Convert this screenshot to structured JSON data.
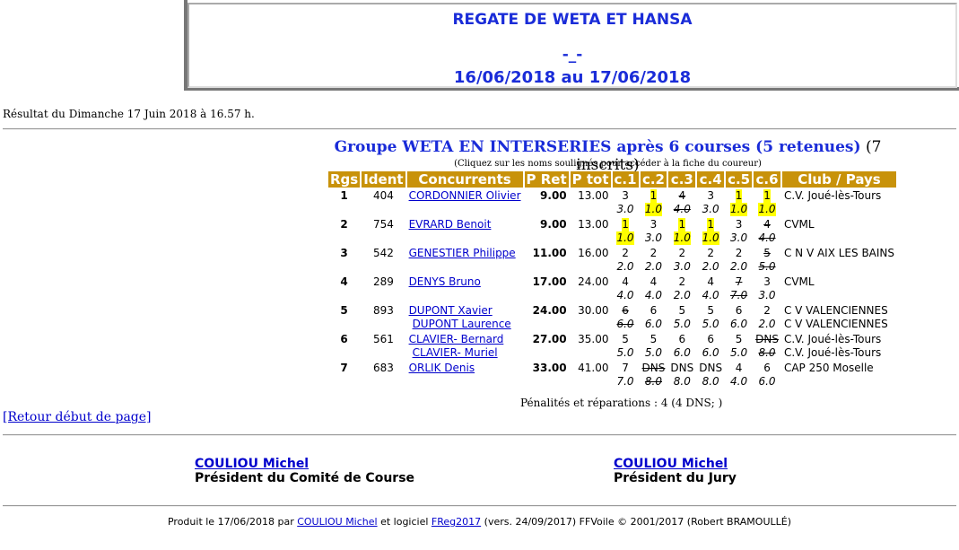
{
  "header": {
    "title": "REGATE DE WETA ET HANSA",
    "separator": "-_-",
    "dates": "16/06/2018 au 17/06/2018"
  },
  "result_line": "Résultat du Dimanche 17 Juin 2018 à 16.57 h.",
  "group": {
    "title": "Groupe WETA EN INTERSERIES après 6 courses (5 retenues)",
    "count": "(7 inscrits)",
    "note": "(Cliquez sur les noms soulignés pour accéder à la fiche du coureur)"
  },
  "table": {
    "headers": [
      "Rgs",
      "Ident",
      "Concurrents",
      "P Ret",
      "P tot",
      "c.1",
      "c.2",
      "c.3",
      "c.4",
      "c.5",
      "c.6",
      "Club / Pays"
    ],
    "rows": [
      {
        "rank": "1",
        "ident": "404",
        "names": [
          "CORDONNIER Olivier"
        ],
        "pret": "9.00",
        "ptot": "13.00",
        "races": [
          {
            "r": "3",
            "p": "3.0",
            "hl": false,
            "s": false
          },
          {
            "r": "1",
            "p": "1.0",
            "hl": true,
            "s": false
          },
          {
            "r": "4",
            "p": "4.0",
            "hl": false,
            "s": true
          },
          {
            "r": "3",
            "p": "3.0",
            "hl": false,
            "s": false
          },
          {
            "r": "1",
            "p": "1.0",
            "hl": true,
            "s": false
          },
          {
            "r": "1",
            "p": "1.0",
            "hl": true,
            "s": false
          }
        ],
        "clubs": [
          "C.V. Joué-lès-Tours"
        ]
      },
      {
        "rank": "2",
        "ident": "754",
        "names": [
          "EVRARD Benoit"
        ],
        "pret": "9.00",
        "ptot": "13.00",
        "races": [
          {
            "r": "1",
            "p": "1.0",
            "hl": true,
            "s": false
          },
          {
            "r": "3",
            "p": "3.0",
            "hl": false,
            "s": false
          },
          {
            "r": "1",
            "p": "1.0",
            "hl": true,
            "s": false
          },
          {
            "r": "1",
            "p": "1.0",
            "hl": true,
            "s": false
          },
          {
            "r": "3",
            "p": "3.0",
            "hl": false,
            "s": false
          },
          {
            "r": "4",
            "p": "4.0",
            "hl": false,
            "s": true
          }
        ],
        "clubs": [
          "CVML"
        ]
      },
      {
        "rank": "3",
        "ident": "542",
        "names": [
          "GENESTIER Philippe"
        ],
        "pret": "11.00",
        "ptot": "16.00",
        "races": [
          {
            "r": "2",
            "p": "2.0",
            "hl": false,
            "s": false
          },
          {
            "r": "2",
            "p": "2.0",
            "hl": false,
            "s": false
          },
          {
            "r": "2",
            "p": "3.0",
            "hl": false,
            "s": false
          },
          {
            "r": "2",
            "p": "2.0",
            "hl": false,
            "s": false
          },
          {
            "r": "2",
            "p": "2.0",
            "hl": false,
            "s": false
          },
          {
            "r": "5",
            "p": "5.0",
            "hl": false,
            "s": true
          }
        ],
        "clubs": [
          "C N V AIX LES BAINS"
        ]
      },
      {
        "rank": "4",
        "ident": "289",
        "names": [
          "DENYS Bruno"
        ],
        "pret": "17.00",
        "ptot": "24.00",
        "races": [
          {
            "r": "4",
            "p": "4.0",
            "hl": false,
            "s": false
          },
          {
            "r": "4",
            "p": "4.0",
            "hl": false,
            "s": false
          },
          {
            "r": "2",
            "p": "2.0",
            "hl": false,
            "s": false
          },
          {
            "r": "4",
            "p": "4.0",
            "hl": false,
            "s": false
          },
          {
            "r": "7",
            "p": "7.0",
            "hl": false,
            "s": true
          },
          {
            "r": "3",
            "p": "3.0",
            "hl": false,
            "s": false
          }
        ],
        "clubs": [
          "CVML"
        ]
      },
      {
        "rank": "5",
        "ident": "893",
        "names": [
          "DUPONT Xavier",
          "DUPONT Laurence"
        ],
        "pret": "24.00",
        "ptot": "30.00",
        "races": [
          {
            "r": "6",
            "p": "6.0",
            "hl": false,
            "s": true
          },
          {
            "r": "6",
            "p": "6.0",
            "hl": false,
            "s": false
          },
          {
            "r": "5",
            "p": "5.0",
            "hl": false,
            "s": false
          },
          {
            "r": "5",
            "p": "5.0",
            "hl": false,
            "s": false
          },
          {
            "r": "6",
            "p": "6.0",
            "hl": false,
            "s": false
          },
          {
            "r": "2",
            "p": "2.0",
            "hl": false,
            "s": false
          }
        ],
        "clubs": [
          "C V VALENCIENNES",
          "C V VALENCIENNES"
        ]
      },
      {
        "rank": "6",
        "ident": "561",
        "names": [
          "CLAVIER- Bernard",
          "CLAVIER- Muriel"
        ],
        "pret": "27.00",
        "ptot": "35.00",
        "races": [
          {
            "r": "5",
            "p": "5.0",
            "hl": false,
            "s": false
          },
          {
            "r": "5",
            "p": "5.0",
            "hl": false,
            "s": false
          },
          {
            "r": "6",
            "p": "6.0",
            "hl": false,
            "s": false
          },
          {
            "r": "6",
            "p": "6.0",
            "hl": false,
            "s": false
          },
          {
            "r": "5",
            "p": "5.0",
            "hl": false,
            "s": false
          },
          {
            "r": "DNS",
            "p": "8.0",
            "hl": false,
            "s": true
          }
        ],
        "clubs": [
          "C.V. Joué-lès-Tours",
          "C.V. Joué-lès-Tours"
        ]
      },
      {
        "rank": "7",
        "ident": "683",
        "names": [
          "ORLIK Denis"
        ],
        "pret": "33.00",
        "ptot": "41.00",
        "races": [
          {
            "r": "7",
            "p": "7.0",
            "hl": false,
            "s": false
          },
          {
            "r": "DNS",
            "p": "8.0",
            "hl": false,
            "s": true
          },
          {
            "r": "DNS",
            "p": "8.0",
            "hl": false,
            "s": false
          },
          {
            "r": "DNS",
            "p": "8.0",
            "hl": false,
            "s": false
          },
          {
            "r": "4",
            "p": "4.0",
            "hl": false,
            "s": false
          },
          {
            "r": "6",
            "p": "6.0",
            "hl": false,
            "s": false
          }
        ],
        "clubs": [
          "CAP 250 Moselle"
        ]
      }
    ]
  },
  "penalties": "Pénalités et réparations : 4 (4 DNS; )",
  "back_link": "[Retour début de page]",
  "signatures": [
    {
      "name": "COULIOU Michel",
      "role": "Président du Comité de Course"
    },
    {
      "name": "COULIOU Michel",
      "role": "Président du Jury"
    }
  ],
  "footer": {
    "prefix": "Produit le 17/06/2018 par",
    "author": "COULIOU Michel",
    "middle": "et logiciel",
    "software": "FReg2017",
    "suffix": "(vers. 24/09/2017) FFVoile © 2001/2017 (Robert BRAMOULLÉ)"
  },
  "colors": {
    "header_text": "#1a2cd8",
    "table_header_bg": "#c8920a",
    "highlight": "#ffff00",
    "link": "#0000cc"
  }
}
